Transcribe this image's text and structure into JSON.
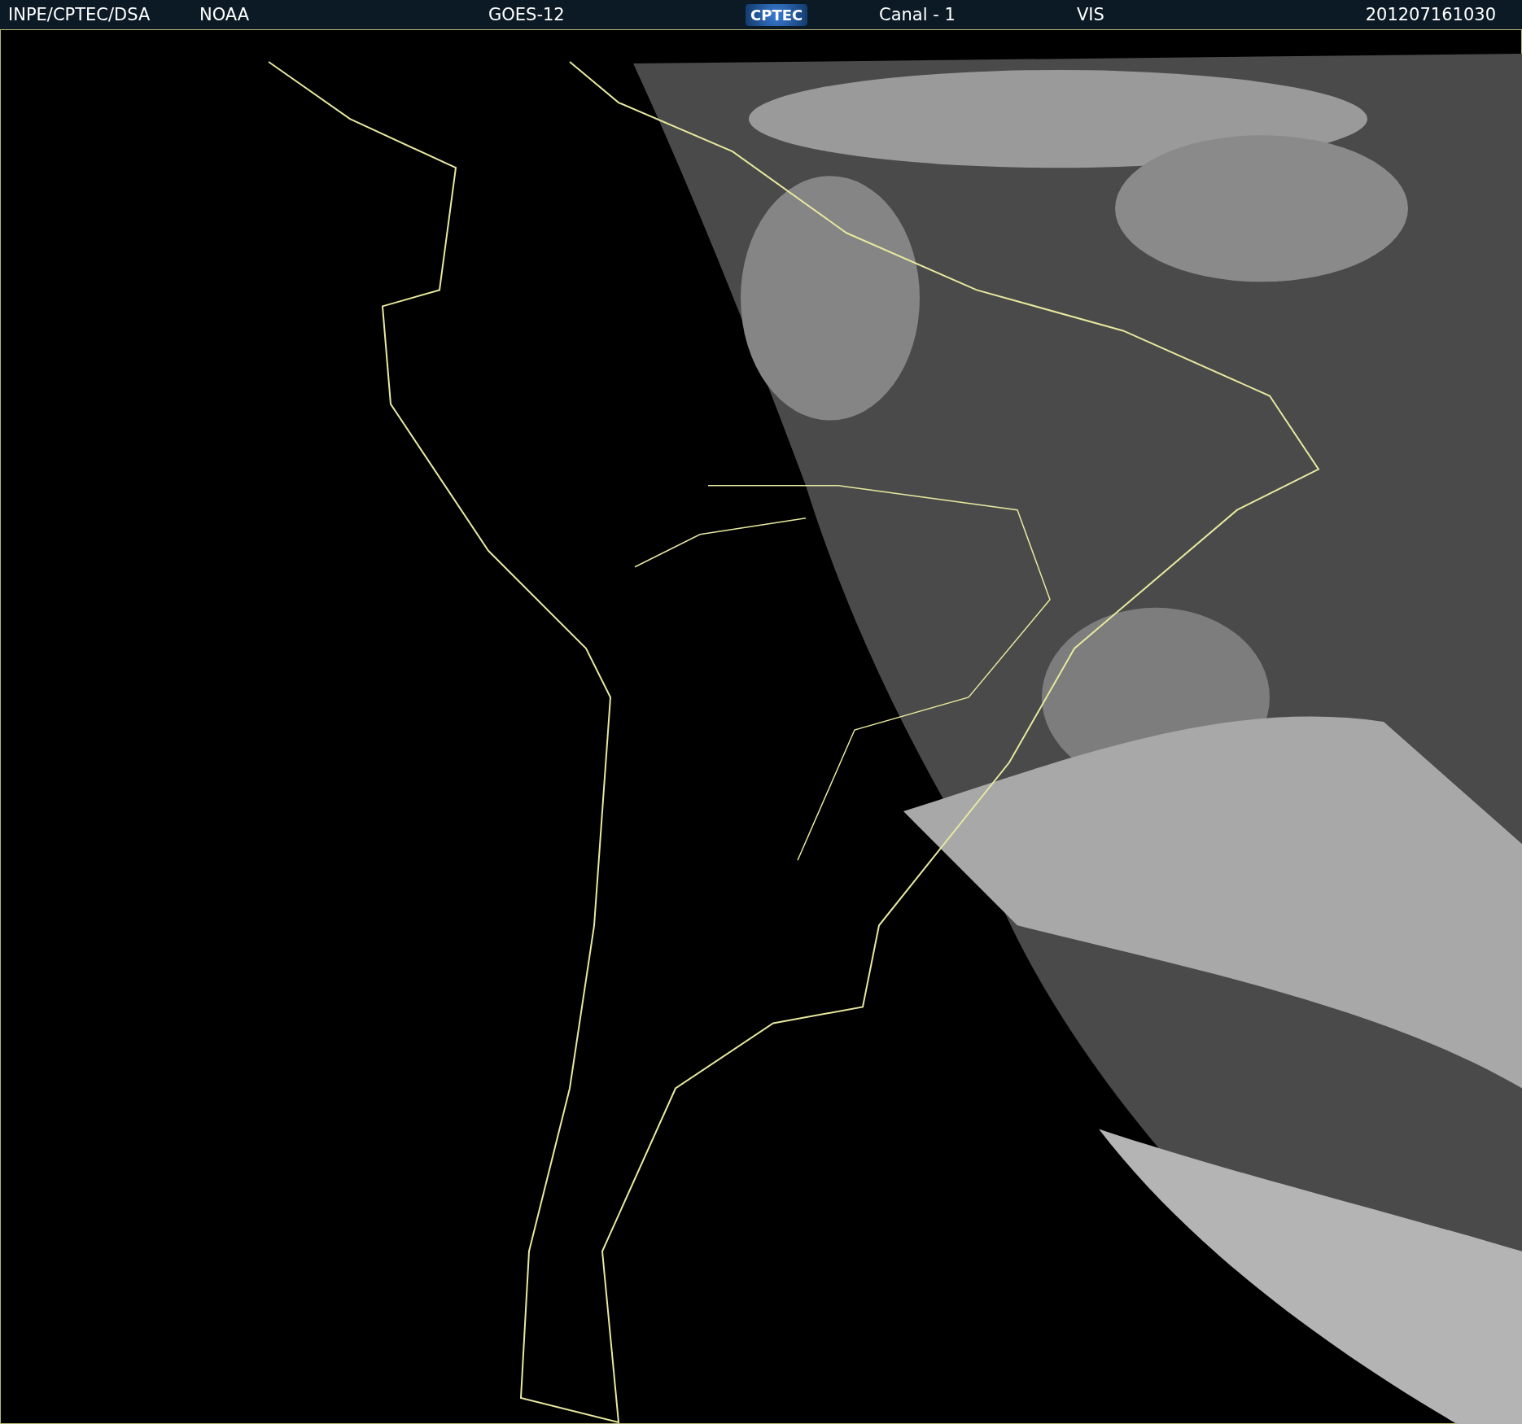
{
  "header": {
    "source": "INPE/CPTEC/DSA",
    "agency": "NOAA",
    "satellite": "GOES-12",
    "logo": "CPTEC",
    "channel": "Canal - 1",
    "band": "VIS",
    "timestamp": "201207161030"
  }
}
